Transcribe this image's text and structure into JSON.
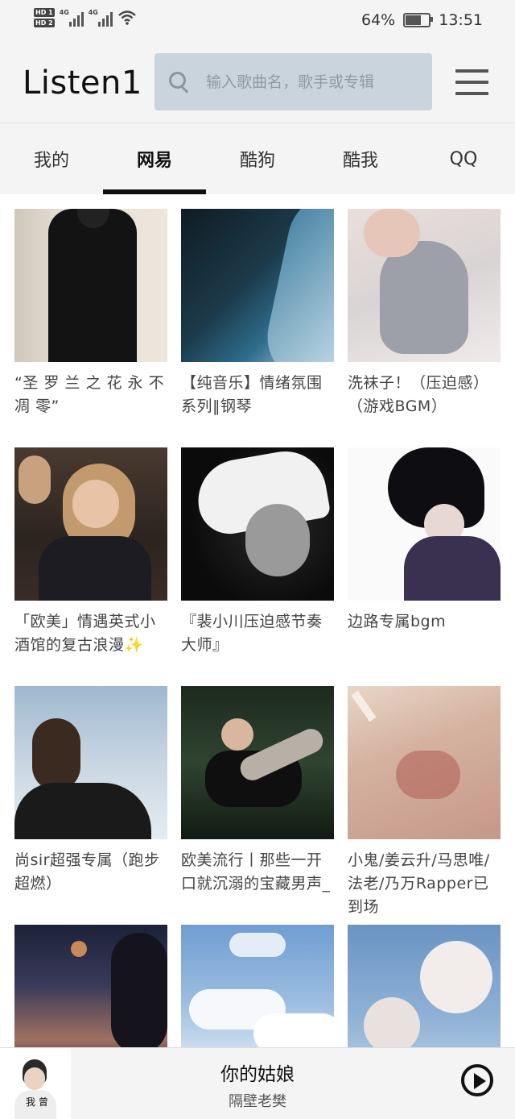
{
  "status_bar": {
    "sim_labels": [
      "HD 1",
      "HD 2"
    ],
    "network_1": "4G",
    "network_2": "4G",
    "battery_percent": "64%",
    "battery_level": 0.64,
    "time": "13:51"
  },
  "app_bar": {
    "title": "Listen1",
    "search_placeholder": "输入歌曲名，歌手或专辑",
    "menu_icon": "hamburger-menu-icon"
  },
  "tabs": [
    {
      "label": "我的",
      "active": false
    },
    {
      "label": "网易",
      "active": true
    },
    {
      "label": "酷狗",
      "active": false
    },
    {
      "label": "酷我",
      "active": false
    },
    {
      "label": "QQ",
      "active": false
    }
  ],
  "playlists": [
    {
      "title": "“圣 罗 兰 之 花 永 不 凋 零”"
    },
    {
      "title": "【纯音乐】情绪氛围系列‖钢琴"
    },
    {
      "title": "洗袜子！（压迫感）（游戏BGM）"
    },
    {
      "title": "「欧美」情遇英式小酒馆的复古浪漫✨"
    },
    {
      "title": "『裴小川压迫感节奏大师』"
    },
    {
      "title": "边路专属bgm"
    },
    {
      "title": "尚sir超强专属（跑步超燃）"
    },
    {
      "title": "欧美流行丨那些一开口就沉溺的宝藏男声_"
    },
    {
      "title": "小鬼/姜云升/马思唯/法老/乃万Rapper已到场"
    },
    {
      "title": ""
    },
    {
      "title": ""
    },
    {
      "title": ""
    }
  ],
  "player": {
    "song_title": "你的姑娘",
    "artist": "隔壁老樊",
    "art_text": "我 曾",
    "play_icon": "play-circle-icon"
  },
  "colors": {
    "bar_bg": "#f4f4f4",
    "search_bg": "#c9d4dd",
    "active_tab_indicator": "#111111"
  }
}
